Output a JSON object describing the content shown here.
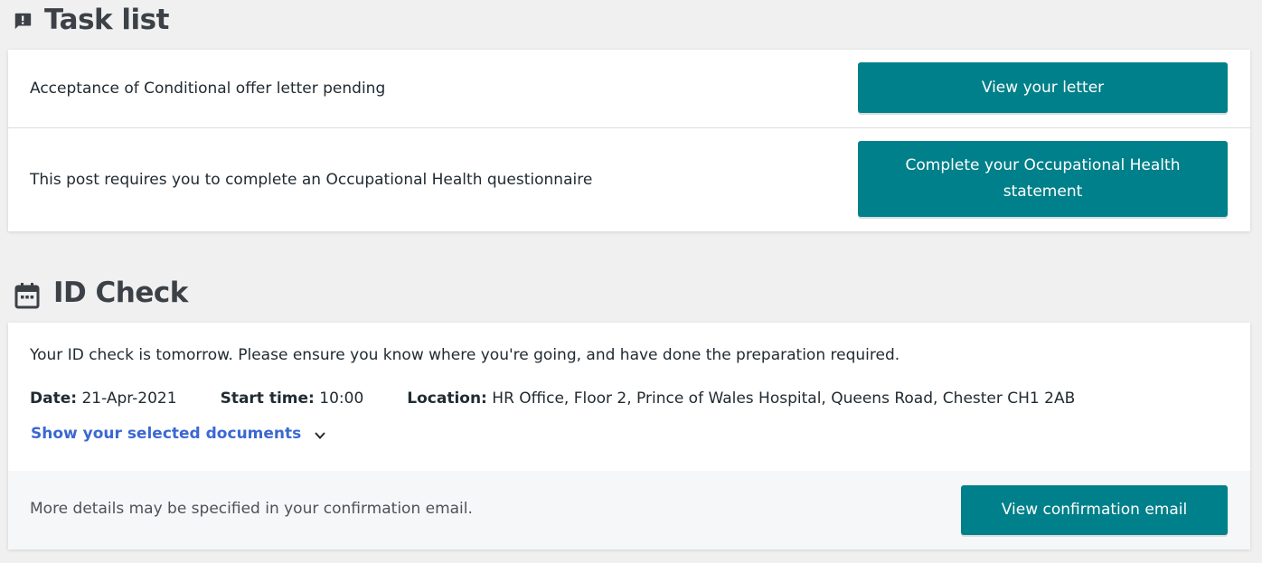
{
  "task_list": {
    "title": "Task list",
    "icon": "feedback-icon",
    "tasks": [
      {
        "text": "Acceptance of Conditional offer letter pending",
        "button_label": "View your letter"
      },
      {
        "text": "This post requires you to complete an Occupational Health questionnaire",
        "button_label": "Complete your Occupational Health statement"
      }
    ]
  },
  "id_check": {
    "title": "ID Check",
    "icon": "calendar-icon",
    "intro": "Your ID check is tomorrow. Please ensure you know where you're going, and have done the preparation required.",
    "date_label": "Date:",
    "date_value": "21-Apr-2021",
    "start_label": "Start time:",
    "start_value": "10:00",
    "location_label": "Location:",
    "location_value": "HR Office, Floor 2, Prince of Wales Hospital, Queens Road, Chester CH1 2AB",
    "show_docs_label": "Show your selected documents",
    "footer_text": "More details may be specified in your confirmation email.",
    "confirm_button_label": "View confirmation email"
  },
  "colors": {
    "button_bg": "#00808a",
    "link": "#3b68d1",
    "page_bg": "#f0f0f0"
  }
}
